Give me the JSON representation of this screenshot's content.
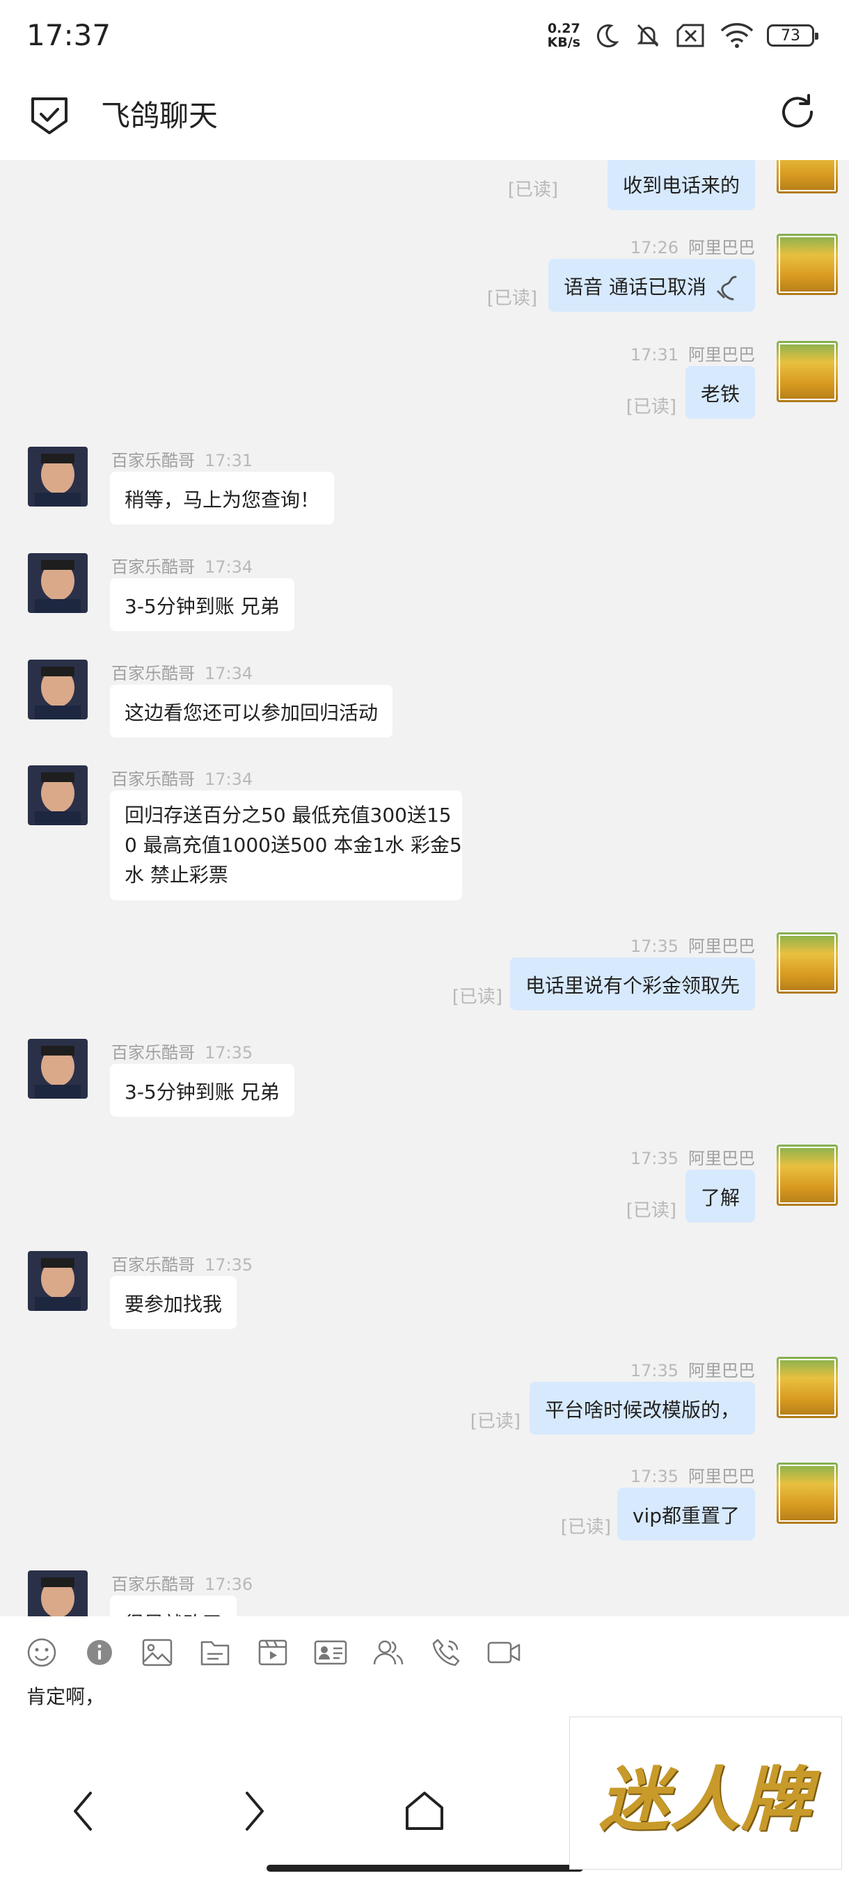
{
  "status": {
    "time": "17:37",
    "netspeed_value": "0.27",
    "netspeed_unit": "KB/s",
    "battery": "73"
  },
  "header": {
    "title": "飞鸽聊天"
  },
  "messages": [
    {
      "side": "right",
      "name": "",
      "time": "",
      "text": "收到电话来的",
      "read": "[已读]"
    },
    {
      "side": "right",
      "name": "阿里巴巴",
      "time": "17:26",
      "text": "语音 通话已取消",
      "read": "[已读]"
    },
    {
      "side": "right",
      "name": "阿里巴巴",
      "time": "17:31",
      "text": "老铁",
      "read": "[已读]"
    },
    {
      "side": "left",
      "name": "百家乐酷哥",
      "time": "17:31",
      "text": "稍等，马上为您查询！"
    },
    {
      "side": "left",
      "name": "百家乐酷哥",
      "time": "17:34",
      "text": "3-5分钟到账 兄弟"
    },
    {
      "side": "left",
      "name": "百家乐酷哥",
      "time": "17:34",
      "text": "这边看您还可以参加回归活动"
    },
    {
      "side": "left",
      "name": "百家乐酷哥",
      "time": "17:34",
      "lines": [
        "回归存送百分之50 最低充值300送15",
        "0 最高充值1000送500 本金1水 彩金5",
        "水 禁止彩票"
      ]
    },
    {
      "side": "right",
      "name": "阿里巴巴",
      "time": "17:35",
      "text": "电话里说有个彩金领取先",
      "read": "[已读]"
    },
    {
      "side": "left",
      "name": "百家乐酷哥",
      "time": "17:35",
      "text": "3-5分钟到账 兄弟"
    },
    {
      "side": "right",
      "name": "阿里巴巴",
      "time": "17:35",
      "text": "了解",
      "read": "[已读]"
    },
    {
      "side": "left",
      "name": "百家乐酷哥",
      "time": "17:35",
      "text": "要参加找我"
    },
    {
      "side": "right",
      "name": "阿里巴巴",
      "time": "17:35",
      "text": "平台啥时候改模版的，",
      "read": "[已读]"
    },
    {
      "side": "right",
      "name": "阿里巴巴",
      "time": "17:35",
      "text": "vip都重置了",
      "read": "[已读]"
    },
    {
      "side": "left",
      "name": "百家乐酷哥",
      "time": "17:36",
      "text": "很早就改了"
    }
  ],
  "input": {
    "text": "肯定啊，"
  },
  "toolbar_icons": [
    "emoji-icon",
    "info-icon",
    "image-icon",
    "file-icon",
    "video-clip-icon",
    "contact-card-icon",
    "group-icon",
    "phone-call-icon",
    "video-call-icon"
  ],
  "watermark": {
    "text": "迷人牌"
  },
  "colors": {
    "bubble_self": "#d7e9fd",
    "bubble_other": "#ffffff",
    "background": "#f2f2f2",
    "read_text": "#b8b8b8"
  }
}
